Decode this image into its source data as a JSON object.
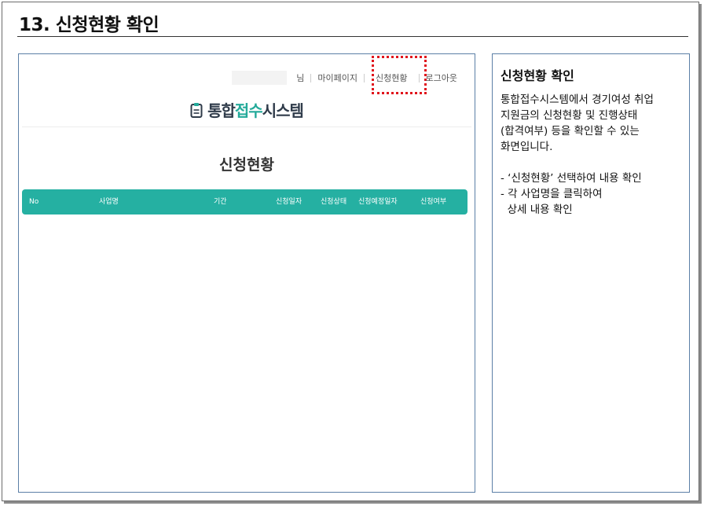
{
  "slide": {
    "title": "13. 신청현황 확인"
  },
  "screen": {
    "nav": {
      "user_suffix": "님",
      "items": [
        "마이페이지",
        "신청현황",
        "로그아웃"
      ]
    },
    "logo": {
      "prefix": "통합",
      "accent": "접수",
      "suffix": "시스템",
      "icon": "clipboard-icon"
    },
    "heading": "신청현황",
    "table": {
      "columns": [
        "No",
        "사업명",
        "기간",
        "신청일자",
        "신청상태",
        "신청예정일자",
        "신청여부"
      ],
      "header_color": "#25b0a2"
    },
    "highlight_color": "#e0141c"
  },
  "description": {
    "title": "신청현황 확인",
    "body": "통합접수시스템에서 경기여성 취업 지원금의 신청현황 및 진행상태 (합격여부) 등을 확인할 수 있는 화면입니다.",
    "bullets": [
      "- ‘신청현황’ 선택하여 내용 확인",
      "- 각 사업명을 클릭하여",
      "  상세 내용 확인"
    ]
  }
}
